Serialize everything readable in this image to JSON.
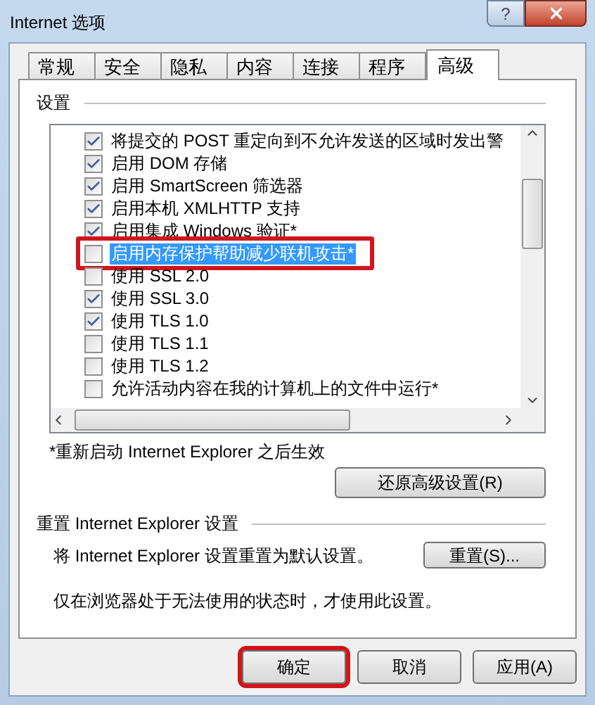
{
  "window": {
    "title": "Internet 选项",
    "help_button": "?"
  },
  "tabs": [
    {
      "label": "常规",
      "selected": false
    },
    {
      "label": "安全",
      "selected": false
    },
    {
      "label": "隐私",
      "selected": false
    },
    {
      "label": "内容",
      "selected": false
    },
    {
      "label": "连接",
      "selected": false
    },
    {
      "label": "程序",
      "selected": false
    },
    {
      "label": "高级",
      "selected": true
    }
  ],
  "settings": {
    "heading": "设置",
    "items": [
      {
        "label": "将提交的 POST 重定向到不允许发送的区域时发出警",
        "checked": true,
        "selected": false,
        "highlighted": false
      },
      {
        "label": "启用 DOM 存储",
        "checked": true,
        "selected": false,
        "highlighted": false
      },
      {
        "label": "启用 SmartScreen 筛选器",
        "checked": true,
        "selected": false,
        "highlighted": false
      },
      {
        "label": "启用本机 XMLHTTP 支持",
        "checked": true,
        "selected": false,
        "highlighted": false
      },
      {
        "label": "启用集成 Windows 验证*",
        "checked": true,
        "selected": false,
        "highlighted": false
      },
      {
        "label": "启用内存保护帮助减少联机攻击*",
        "checked": false,
        "selected": true,
        "highlighted": true
      },
      {
        "label": "使用 SSL 2.0",
        "checked": false,
        "selected": false,
        "highlighted": false
      },
      {
        "label": "使用 SSL 3.0",
        "checked": true,
        "selected": false,
        "highlighted": false
      },
      {
        "label": "使用 TLS 1.0",
        "checked": true,
        "selected": false,
        "highlighted": false
      },
      {
        "label": "使用 TLS 1.1",
        "checked": false,
        "selected": false,
        "highlighted": false
      },
      {
        "label": "使用 TLS 1.2",
        "checked": false,
        "selected": false,
        "highlighted": false
      },
      {
        "label": "允许活动内容在我的计算机上的文件中运行*",
        "checked": false,
        "selected": false,
        "highlighted": false
      }
    ],
    "note": "*重新启动 Internet Explorer 之后生效",
    "restore_button": "还原高级设置(R)"
  },
  "reset": {
    "heading": "重置 Internet Explorer 设置",
    "description": "将 Internet Explorer 设置重置为默认设置。",
    "button": "重置(S)...",
    "warning": "仅在浏览器处于无法使用的状态时，才使用此设置。"
  },
  "buttons": [
    {
      "label": "确定",
      "highlighted": true
    },
    {
      "label": "取消",
      "highlighted": false
    },
    {
      "label": "应用(A)",
      "highlighted": false
    }
  ]
}
